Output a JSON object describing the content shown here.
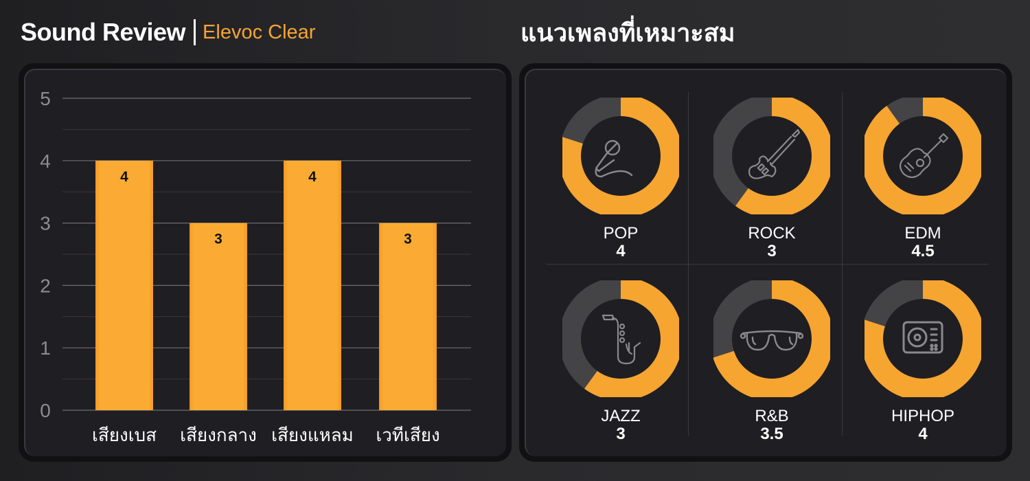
{
  "header": {
    "title": "Sound Review",
    "subtitle": "Elevoc Clear",
    "right_title": "แนวเพลงที่เหมาะสม"
  },
  "colors": {
    "accent": "#f6a530",
    "track": "#444446",
    "panel": "#1f1e22",
    "icon": "#8a8a8e"
  },
  "chart_data": [
    {
      "type": "bar",
      "title": "Sound Review",
      "categories": [
        "เสียงเบส",
        "เสียงกลาง",
        "เสียงแหลม",
        "เวทีเสียง"
      ],
      "values": [
        4,
        3,
        4,
        3
      ],
      "data_labels": [
        "4",
        "3",
        "4",
        "3"
      ],
      "xlabel": "",
      "ylabel": "",
      "ylim": [
        0,
        5
      ],
      "yticks": [
        "0",
        "1",
        "2",
        "3",
        "4",
        "5"
      ],
      "grid": true
    },
    {
      "type": "pie",
      "title": "แนวเพลงที่เหมาะสม",
      "subtype": "donut",
      "max": 5,
      "items": [
        {
          "name": "POP",
          "value": 4,
          "label": "4",
          "icon": "microphone-icon"
        },
        {
          "name": "ROCK",
          "value": 3,
          "label": "3",
          "icon": "electric-guitar-icon"
        },
        {
          "name": "EDM",
          "value": 4.5,
          "label": "4.5",
          "icon": "acoustic-guitar-icon"
        },
        {
          "name": "JAZZ",
          "value": 3,
          "label": "3",
          "icon": "saxophone-icon"
        },
        {
          "name": "R&B",
          "value": 3.5,
          "label": "3.5",
          "icon": "sunglasses-icon"
        },
        {
          "name": "HIPHOP",
          "value": 4,
          "label": "4",
          "icon": "turntable-icon"
        }
      ]
    }
  ]
}
